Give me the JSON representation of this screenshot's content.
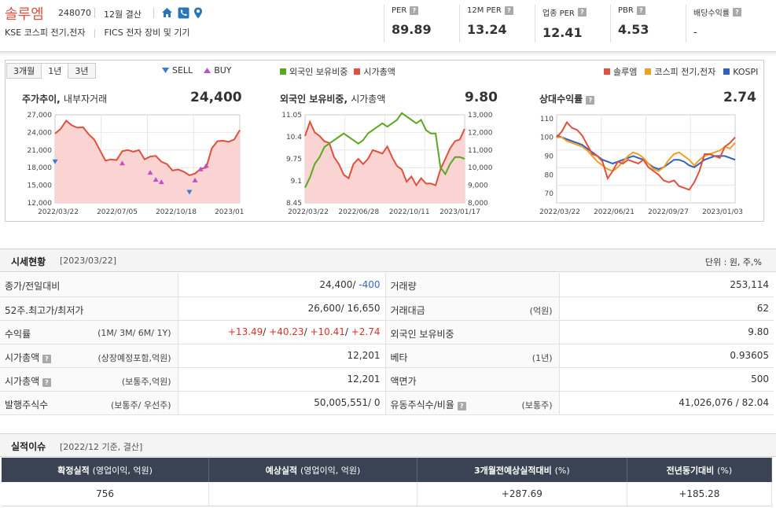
{
  "header": {
    "company_name": "솔루엠",
    "code": "248070",
    "settlement": "12월 결산",
    "market": "KSE  코스피 전기,전자",
    "fics": "FICS 전자 장비 및 기기",
    "icons": [
      "home-icon",
      "phone-icon",
      "location-icon"
    ],
    "metrics": [
      {
        "label": "PER",
        "value": "89.89"
      },
      {
        "label": "12M PER",
        "value": "13.24"
      },
      {
        "label": "업종 PER",
        "value": "12.41"
      },
      {
        "label": "PBR",
        "value": "4.53"
      },
      {
        "label": "배당수익률",
        "value": "-"
      }
    ]
  },
  "chart_panel": {
    "tabs": [
      "3개월",
      "1년",
      "3년"
    ],
    "active_tab": "1년",
    "signal_legend": {
      "sell": "SELL",
      "buy": "BUY"
    },
    "foreign_legend": {
      "foreign": "외국인 보유비중",
      "marketcap": "시가총액"
    },
    "relative_legend": {
      "company": "솔루엠",
      "sector": "코스피 전기,전자",
      "kospi": "KOSPI"
    },
    "colors": {
      "company": "#e0503c",
      "foreign": "#5aa820",
      "sector": "#f0a020",
      "kospi": "#3060c0",
      "sell": "#3a7ad0",
      "buy": "#c050d0"
    }
  },
  "chart_data": [
    {
      "type": "area",
      "title": "주가추이",
      "subtitle": "내부자거래",
      "current": "24,400",
      "x_ticks": [
        "2022/03/22",
        "2022/07/05",
        "2022/10/18",
        "2023/01/31"
      ],
      "y_ticks": [
        "27,000",
        "24,000",
        "21,000",
        "18,000",
        "15,000",
        "12,000"
      ],
      "ylim": [
        12000,
        27000
      ],
      "series": [
        {
          "name": "솔루엠",
          "values": [
            23800,
            24600,
            26000,
            25200,
            24800,
            24900,
            23700,
            22800,
            21000,
            19200,
            19400,
            19300,
            20800,
            21000,
            20700,
            21000,
            19400,
            19900,
            20000,
            19000,
            18600,
            17500,
            17700,
            17300,
            16700,
            17000,
            17800,
            18000,
            21300,
            22500,
            22600,
            22400,
            22800,
            24400
          ]
        }
      ],
      "sell_markers": [
        [
          0,
          19000
        ],
        [
          24,
          13800
        ]
      ],
      "buy_markers": [
        [
          12,
          18800
        ],
        [
          17,
          17200
        ],
        [
          18,
          16000
        ],
        [
          19,
          15600
        ],
        [
          25,
          15900
        ],
        [
          26,
          17800
        ],
        [
          27,
          18400
        ]
      ]
    },
    {
      "type": "line",
      "title": "외국인 보유비중",
      "subtitle": "시가총액",
      "current": "9.80",
      "x_ticks": [
        "2022/03/22",
        "2022/06/28",
        "2022/10/11",
        "2023/01/17"
      ],
      "y_ticks_left": [
        "11.05",
        "10.4",
        "9.75",
        "9.1",
        "8.45"
      ],
      "y_ticks_right": [
        "13,000",
        "12,000",
        "11,000",
        "10,000",
        "9,000",
        "8,000"
      ],
      "ylim_left": [
        8.45,
        11.05
      ],
      "ylim_right": [
        8000,
        13000
      ],
      "series": [
        {
          "name": "외국인 보유비중",
          "axis": "left",
          "values": [
            8.9,
            9.2,
            9.6,
            9.8,
            10.1,
            10.2,
            10.3,
            10.4,
            10.5,
            10.4,
            10.3,
            10.2,
            10.3,
            10.5,
            10.6,
            10.7,
            10.8,
            10.7,
            10.8,
            10.9,
            11.1,
            11.0,
            10.9,
            10.8,
            10.9,
            10.6,
            10.5,
            10.5,
            9.5,
            9.3,
            9.6,
            9.8,
            9.8,
            9.75
          ]
        },
        {
          "name": "시가총액",
          "axis": "right",
          "values": [
            11800,
            12600,
            12000,
            11800,
            11500,
            11400,
            10600,
            10200,
            9600,
            9400,
            10200,
            10500,
            10200,
            10500,
            11000,
            10900,
            10800,
            11200,
            10600,
            10100,
            9900,
            9200,
            9500,
            9000,
            9400,
            9100,
            9100,
            9000,
            9900,
            10500,
            11100,
            11500,
            11600,
            12200
          ]
        }
      ]
    },
    {
      "type": "line",
      "title": "상대수익률",
      "current": "2.74",
      "x_ticks": [
        "2022/03/22",
        "2022/06/21",
        "2022/09/27",
        "2023/01/03"
      ],
      "y_ticks": [
        "110",
        "100",
        "90",
        "80",
        "70"
      ],
      "ylim": [
        65,
        112
      ],
      "series": [
        {
          "name": "솔루엠",
          "values": [
            100,
            103,
            108,
            105,
            104,
            101,
            96,
            91,
            90,
            87,
            78,
            82,
            87,
            86,
            88,
            87,
            86,
            88,
            84,
            82,
            80,
            77,
            76,
            77,
            74,
            73,
            72,
            76,
            82,
            91,
            91,
            90,
            89,
            95,
            97,
            100
          ]
        },
        {
          "name": "코스피 전기,전자",
          "values": [
            100,
            100,
            98,
            97,
            96,
            95,
            93,
            90,
            87,
            85,
            83,
            82,
            84,
            87,
            90,
            92,
            91,
            89,
            86,
            83,
            82,
            84,
            88,
            91,
            92,
            90,
            88,
            85,
            88,
            90,
            91,
            92,
            93,
            95,
            94,
            97
          ]
        },
        {
          "name": "KOSPI",
          "values": [
            101,
            100,
            99,
            98,
            97,
            96,
            94,
            92,
            90,
            88,
            87,
            86,
            87,
            88,
            89,
            90,
            89,
            88,
            86,
            84,
            83,
            84,
            86,
            88,
            88,
            87,
            85,
            84,
            86,
            88,
            89,
            90,
            90,
            90,
            89,
            88
          ]
        }
      ]
    }
  ],
  "market_status": {
    "title": "시세현황",
    "date": "[2023/03/22]",
    "unit": "단위 : 원, 주,%",
    "rows": [
      {
        "label": "종가/전일대비",
        "sub": "",
        "value": "24,400/",
        "value2": " -400",
        "label2": "거래량",
        "sub2": "",
        "val2": "253,114"
      },
      {
        "label": "52주.최고가/최저가",
        "sub": "",
        "value": "26,600/ 16,650",
        "value2": "",
        "label2": "거래대금",
        "sub2": "(억원)",
        "val2": "62"
      },
      {
        "label": "수익률",
        "sub": "(1M/ 3M/ 6M/ 1Y)",
        "value": "",
        "value2": "",
        "label2": "외국인 보유비중",
        "sub2": "",
        "val2": "9.80"
      },
      {
        "label": "시가총액",
        "sub": "(상장예정포함,억원)",
        "value": "12,201",
        "value2": "",
        "label2": "베타",
        "sub2": "(1년)",
        "val2": "0.93605"
      },
      {
        "label": "시가총액",
        "sub": "(보통주,억원)",
        "value": "12,201",
        "value2": "",
        "label2": "액면가",
        "sub2": "",
        "val2": "500"
      },
      {
        "label": "발행주식수",
        "sub": "(보통주/ 우선주)",
        "value": "50,005,551/ 0",
        "value2": "",
        "label2": "유동주식수/비율",
        "sub2": "(보통주)",
        "val2": "41,026,076 / 82.04"
      }
    ],
    "returns": [
      "+13.49",
      "+40.23",
      "+10.41",
      "+2.74"
    ]
  },
  "results": {
    "title": "실적이슈",
    "date": "[2022/12 기준, 결산]",
    "headers": [
      {
        "main": "확정실적",
        "sub": "(영업이익, 억원)"
      },
      {
        "main": "예상실적",
        "sub": "(영업이익, 억원)"
      },
      {
        "main": "3개월전예상실적대비",
        "sub": "(%)"
      },
      {
        "main": "전년동기대비",
        "sub": "(%)"
      }
    ],
    "values": [
      "756",
      "",
      "+287.69",
      "+185.28"
    ]
  }
}
